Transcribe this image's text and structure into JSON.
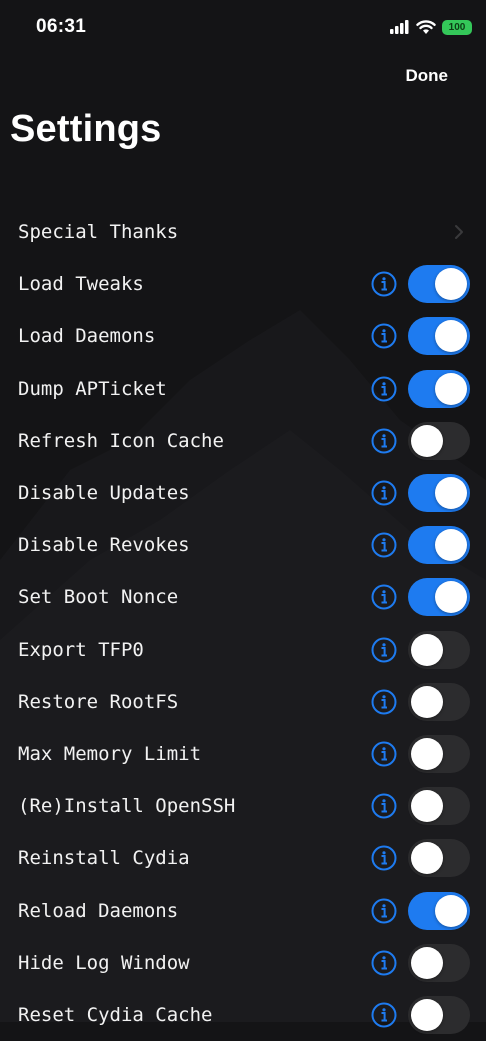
{
  "status_bar": {
    "time": "06:31",
    "battery": "100"
  },
  "nav": {
    "done_label": "Done"
  },
  "title": "Settings",
  "colors": {
    "accent": "#1e7bf0",
    "toggle_off": "#2c2c2e",
    "background": "#141416",
    "battery": "#34c759"
  },
  "rows": [
    {
      "label": "Special Thanks",
      "type": "link"
    },
    {
      "label": "Load Tweaks",
      "type": "toggle",
      "on": true
    },
    {
      "label": "Load Daemons",
      "type": "toggle",
      "on": true
    },
    {
      "label": "Dump APTicket",
      "type": "toggle",
      "on": true
    },
    {
      "label": "Refresh Icon Cache",
      "type": "toggle",
      "on": false
    },
    {
      "label": "Disable Updates",
      "type": "toggle",
      "on": true
    },
    {
      "label": "Disable Revokes",
      "type": "toggle",
      "on": true
    },
    {
      "label": "Set Boot Nonce",
      "type": "toggle",
      "on": true
    },
    {
      "label": "Export TFP0",
      "type": "toggle",
      "on": false
    },
    {
      "label": "Restore RootFS",
      "type": "toggle",
      "on": false
    },
    {
      "label": "Max Memory Limit",
      "type": "toggle",
      "on": false
    },
    {
      "label": "(Re)Install OpenSSH",
      "type": "toggle",
      "on": false
    },
    {
      "label": "Reinstall Cydia",
      "type": "toggle",
      "on": false
    },
    {
      "label": "Reload Daemons",
      "type": "toggle",
      "on": true
    },
    {
      "label": "Hide Log Window",
      "type": "toggle",
      "on": false
    },
    {
      "label": "Reset Cydia Cache",
      "type": "toggle",
      "on": false
    }
  ]
}
